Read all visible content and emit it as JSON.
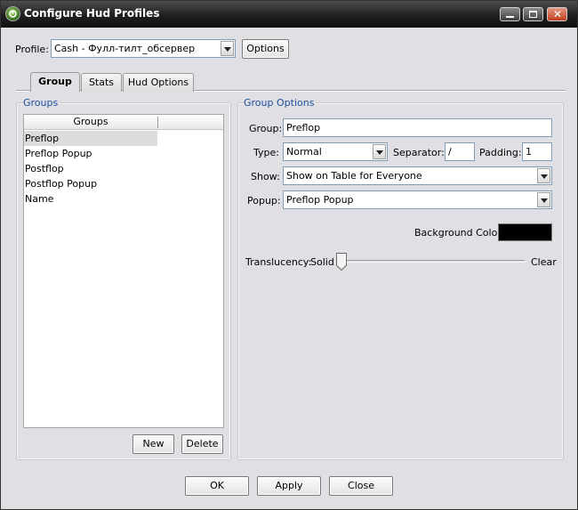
{
  "window": {
    "title": "Configure Hud Profiles"
  },
  "profile": {
    "label": "Profile:",
    "value": "Cash - Фулл-тилт_обсервер",
    "options_button": "Options"
  },
  "tabs": [
    {
      "label": "Group",
      "active": true
    },
    {
      "label": "Stats",
      "active": false
    },
    {
      "label": "Hud Options",
      "active": false
    }
  ],
  "groups_panel": {
    "title": "Groups",
    "column_header": "Groups",
    "items": [
      "Preflop",
      "Preflop Popup",
      "Postflop",
      "Postflop Popup",
      "Name"
    ],
    "selected": "Preflop",
    "new_button": "New",
    "delete_button": "Delete"
  },
  "group_options": {
    "title": "Group Options",
    "group_label": "Group:",
    "group_value": "Preflop",
    "type_label": "Type:",
    "type_value": "Normal",
    "separator_label": "Separator:",
    "separator_value": "/",
    "padding_label": "Padding:",
    "padding_value": "1",
    "show_label": "Show:",
    "show_value": "Show on Table for Everyone",
    "popup_label": "Popup:",
    "popup_value": "Preflop Popup",
    "background_color_label": "Background Color:",
    "background_color": "#000000",
    "translucency_label": "Translucency:",
    "translucency_min": "Solid",
    "translucency_max": "Clear",
    "translucency_value": 0.0
  },
  "footer": {
    "ok": "OK",
    "apply": "Apply",
    "close": "Close"
  },
  "colors": {
    "group_title": "#1d4fa3",
    "window_bg": "#e0dfe3"
  }
}
